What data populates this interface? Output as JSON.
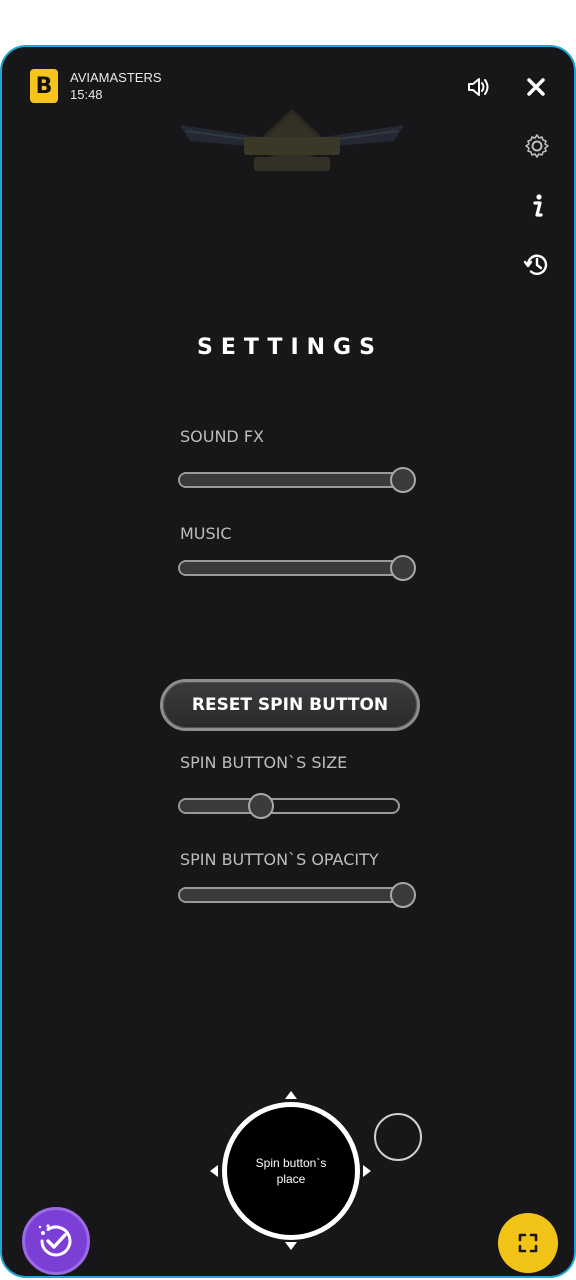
{
  "header": {
    "brand_logo": "B",
    "game_name": "AVIAMASTERS",
    "time": "15:48"
  },
  "icons": {
    "sound": "speaker-icon",
    "close": "close-icon",
    "settings": "gear-icon",
    "info": "info-icon",
    "history": "history-icon",
    "bonus": "bonus-icon",
    "fullscreen": "fullscreen-icon"
  },
  "settings": {
    "title": "SETTINGS",
    "sound_fx": {
      "label": "SOUND FX",
      "value": 100
    },
    "music": {
      "label": "MUSIC",
      "value": 100
    },
    "reset_label": "RESET SPIN BUTTON",
    "spin_size": {
      "label": "SPIN BUTTON`S SIZE",
      "value": 35
    },
    "spin_opacity": {
      "label": "SPIN BUTTON`S OPACITY",
      "value": 100
    }
  },
  "spin_button": {
    "label": "Spin button`s place"
  },
  "colors": {
    "accent_yellow": "#f3c418",
    "bonus_purple": "#7c3fd6",
    "frame_border": "#1fa6d6",
    "background": "#171719"
  }
}
